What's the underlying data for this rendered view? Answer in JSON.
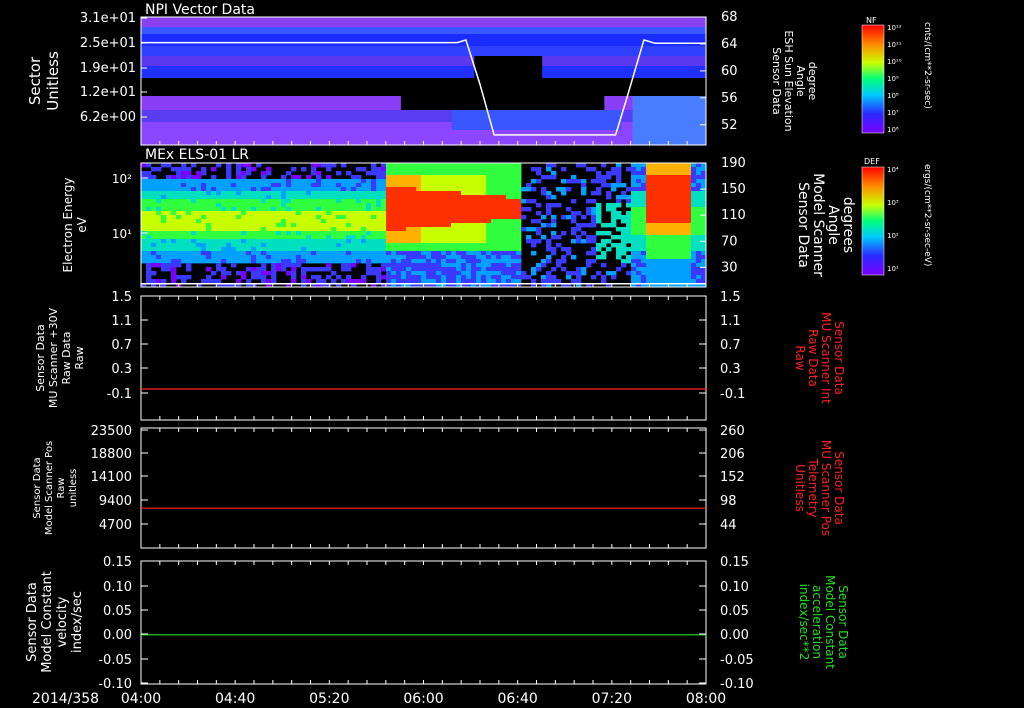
{
  "chart_data": [
    {
      "type": "heatmap",
      "title": "NPI Vector Data",
      "ylabel": [
        "Sector",
        "Unitless"
      ],
      "y_ticks": [
        "3.1e+01",
        "2.5e+01",
        "1.9e+01",
        "1.2e+01",
        "6.2e+00"
      ],
      "right_ylabel": [
        "Sensor Data",
        "ESH Sun Elevation",
        "Angle",
        "degree"
      ],
      "right_y_ticks": [
        "68",
        "64",
        "60",
        "56",
        "52"
      ],
      "right_ylim": [
        49,
        68
      ],
      "overlay_line": {
        "name": "ESH Sun Elevation Angle",
        "color": "#ffffff",
        "points": [
          [
            0,
            64.2
          ],
          [
            0.56,
            64.2
          ],
          [
            0.575,
            64.6
          ],
          [
            0.6,
            58
          ],
          [
            0.625,
            50.5
          ],
          [
            0.84,
            50.5
          ],
          [
            0.86,
            56
          ],
          [
            0.89,
            64.6
          ],
          [
            0.91,
            64.1
          ],
          [
            1,
            64.1
          ]
        ]
      },
      "colorbar": {
        "label": "NF",
        "unit": "cnts/(cm**2-sr-sec)",
        "ticks": [
          "10¹²",
          "10¹¹",
          "10¹⁰",
          "10⁹",
          "10⁸",
          "10⁷",
          "10⁶"
        ]
      }
    },
    {
      "type": "heatmap",
      "title": "MEx ELS-01 LR",
      "ylabel": [
        "Electron Energy",
        "eV"
      ],
      "y_ticks": [
        "10²",
        "10¹"
      ],
      "right_ylabel": [
        "Sensor Data",
        "Model Scanner",
        "Angle",
        "degrees"
      ],
      "right_y_ticks": [
        "190",
        "150",
        "110",
        "70",
        "30"
      ],
      "right_ylim": [
        0,
        190
      ],
      "overlay_line": {
        "color": "#ffffff",
        "value": 5
      },
      "colorbar": {
        "label": "DEF",
        "unit": "ergs/(cm**2-sr-sec-eV)",
        "ticks": [
          "10⁴",
          "10³",
          "10²",
          "10¹"
        ]
      }
    },
    {
      "type": "line",
      "ylabel": [
        "Sensor Data",
        "MU Scanner +30V",
        "Raw Data",
        "Raw"
      ],
      "y_ticks": [
        "1.5",
        "1.1",
        "0.7",
        "0.3",
        "-0.1"
      ],
      "ylim": [
        -0.5,
        1.5
      ],
      "right_ylabel": [
        "Sensor Data",
        "MU Scanner Int",
        "Raw Data",
        "Raw"
      ],
      "right_y_ticks": [
        "1.5",
        "1.1",
        "0.7",
        "0.3",
        "-0.1"
      ],
      "series": [
        {
          "color": "#ff2020",
          "value": 0.0
        }
      ],
      "right_label_color": "#ff2020"
    },
    {
      "type": "line",
      "ylabel": [
        "Sensor Data",
        "Model Scanner Pos",
        "Raw",
        "unitless"
      ],
      "y_ticks": [
        "23500",
        "18800",
        "14100",
        "9400",
        "4700"
      ],
      "ylim": [
        0,
        23500
      ],
      "right_ylabel": [
        "Sensor Data",
        "MU Scanner Pos",
        "Telemetry",
        "Unitless"
      ],
      "right_y_ticks": [
        "260",
        "206",
        "152",
        "98",
        "44"
      ],
      "series": [
        {
          "color": "#ff2020",
          "value": 7800
        }
      ],
      "right_label_color": "#ff2020"
    },
    {
      "type": "line",
      "ylabel": [
        "Sensor Data",
        "Model Constant",
        "velocity",
        "index/sec"
      ],
      "y_ticks": [
        "0.15",
        "0.10",
        "0.05",
        "0.00",
        "-0.05",
        "-0.10"
      ],
      "ylim": [
        -0.1,
        0.15
      ],
      "right_ylabel": [
        "Sensor Data",
        "Model Constant",
        "acceleration",
        "index/sec**2"
      ],
      "right_y_ticks": [
        "0.15",
        "0.10",
        "0.05",
        "0.00",
        "-0.05",
        "-0.10"
      ],
      "series": [
        {
          "color": "#20e020",
          "value": 0.0
        }
      ],
      "right_label_color": "#20e020"
    }
  ],
  "x_axis": {
    "date_label": "2014/358",
    "ticks": [
      "04:00",
      "04:40",
      "05:20",
      "06:00",
      "06:40",
      "07:20",
      "08:00"
    ]
  }
}
